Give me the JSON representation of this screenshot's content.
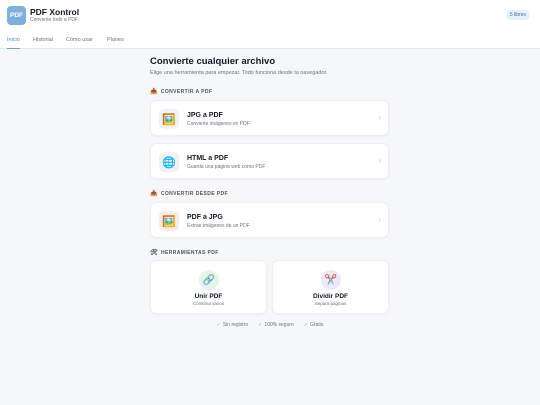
{
  "header": {
    "logo_text": "PDF",
    "title": "PDF Xontrol",
    "subtitle": "Convierte todo a PDF",
    "badge": "5 libres"
  },
  "tabs": [
    {
      "label": "Inicio",
      "active": true
    },
    {
      "label": "Historial",
      "active": false
    },
    {
      "label": "Cómo usar",
      "active": false
    },
    {
      "label": "Planes",
      "active": false
    }
  ],
  "main": {
    "title": "Convierte cualquier archivo",
    "subtitle": "Elige una herramienta para empezar. Todo funciona desde tu navegador."
  },
  "sections": {
    "to_pdf": {
      "icon": "📥",
      "label": "CONVERTIR A PDF"
    },
    "from_pdf": {
      "icon": "📤",
      "label": "CONVERTIR DESDE PDF"
    },
    "tools": {
      "icon": "🛠",
      "label": "HERRAMIENTAS PDF"
    }
  },
  "cards": [
    {
      "icon": "🖼️",
      "icon_name": "image-icon",
      "title": "JPG a PDF",
      "subtitle": "Convierte imágenes en PDF",
      "bg": "#eef1f5"
    },
    {
      "icon": "🌐",
      "icon_name": "globe-icon",
      "title": "HTML a PDF",
      "subtitle": "Guarda una página web como PDF",
      "bg": "#eef1f5"
    },
    {
      "icon": "🖼️",
      "icon_name": "image-icon",
      "title": "PDF a JPG",
      "subtitle": "Extrae imágenes de un PDF",
      "bg": "#fbeaea"
    }
  ],
  "tools": [
    {
      "icon": "🔗",
      "icon_name": "link-icon",
      "title": "Unir PDF",
      "subtitle": "Combina varios",
      "bg": "#e4f4ec"
    },
    {
      "icon": "✂️",
      "icon_name": "scissors-icon",
      "title": "Dividir PDF",
      "subtitle": "Separa páginas",
      "bg": "#f0e8f8"
    }
  ],
  "footer": [
    {
      "check": "✓",
      "label": "Sin registro"
    },
    {
      "check": "✓",
      "label": "100% seguro"
    },
    {
      "check": "✓",
      "label": "Gratis"
    }
  ],
  "chevron": "›"
}
